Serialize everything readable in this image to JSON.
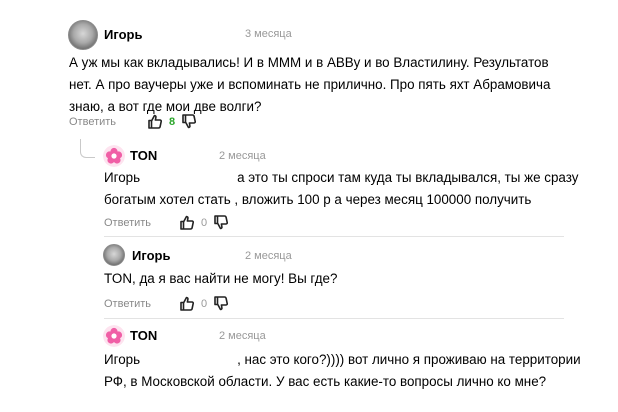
{
  "comments": [
    {
      "author": "Игорь",
      "date": "3 месяца",
      "avatar_icon": "gray-avatar-icon",
      "text_lines": [
        "А уж мы как вкладывались! И в МММ и в АВВу и во Властилину. Результатов",
        "нет. А про ваучеры уже и вспоминать не прилично. Про пять яхт Абрамовича",
        "знаю, а вот где мои две волги?"
      ],
      "reply_label": "Ответить",
      "likes": "8"
    },
    {
      "author": "TON",
      "date": "2 месяца",
      "avatar_icon": "pink-flower-avatar-icon",
      "text_lines": [
        {
          "pre": "Игорь",
          "post": "а это ты спроси там куда ты вкладывался, ты же сразу"
        },
        "богатым хотел стать , вложить 100 р а через месяц 100000 получить"
      ],
      "reply_label": "Ответить",
      "likes": "0"
    },
    {
      "author": "Игорь",
      "date": "2 месяца",
      "avatar_icon": "gray-avatar-icon",
      "text_lines": [
        "TON, да я вас найти не могу! Вы где?"
      ],
      "reply_label": "Ответить",
      "likes": "0"
    },
    {
      "author": "TON",
      "date": "2 месяца",
      "avatar_icon": "pink-flower-avatar-icon",
      "text_lines": [
        {
          "pre": "Игорь",
          "post": ", нас это кого?)))) вот лично я проживаю на территории"
        },
        "РФ, в Московской области. У вас есть какие-то вопросы лично ко мне?"
      ]
    }
  ],
  "colors": {
    "positive_count": "#2ba52b",
    "meta_gray": "#999999",
    "avatar_pink": "#f05fa6"
  }
}
